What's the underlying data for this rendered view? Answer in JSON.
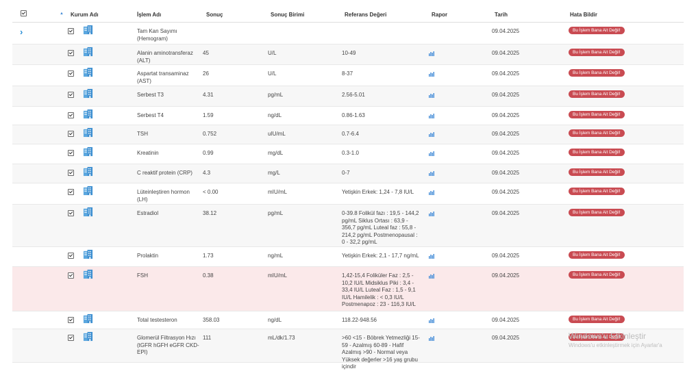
{
  "header": {
    "kurum_adi": "Kurum Adı",
    "islem_adi": "İşlem Adı",
    "sonuc": "Sonuç",
    "sonuc_birimi": "Sonuç Birimi",
    "referans": "Referans Değeri",
    "rapor": "Rapor",
    "tarih": "Tarih",
    "hata": "Hata Bildir"
  },
  "button_label": "Bu İşlem Bana Ait Değil!",
  "rows": [
    {
      "name": "Tam Kan Sayımı (Hemogram)",
      "result": "",
      "unit": "",
      "ref": "",
      "date": "09.04.2025",
      "report": false
    },
    {
      "name": "Alanin aminotransferaz (ALT)",
      "result": "45",
      "unit": "U/L",
      "ref": "10-49",
      "date": "09.04.2025",
      "report": true
    },
    {
      "name": "Aspartat transaminaz (AST)",
      "result": "26",
      "unit": "U/L",
      "ref": "8-37",
      "date": "09.04.2025",
      "report": true
    },
    {
      "name": "Serbest T3",
      "result": "4.31",
      "unit": "pg/mL",
      "ref": "2.56-5.01",
      "date": "09.04.2025",
      "report": true
    },
    {
      "name": "Serbest T4",
      "result": "1.59",
      "unit": "ng/dL",
      "ref": "0.86-1.63",
      "date": "09.04.2025",
      "report": true
    },
    {
      "name": "TSH",
      "result": "0.752",
      "unit": "uIU/mL",
      "ref": "0.7-6.4",
      "date": "09.04.2025",
      "report": true
    },
    {
      "name": "Kreatinin",
      "result": "0.99",
      "unit": "mg/dL",
      "ref": "0.3-1.0",
      "date": "09.04.2025",
      "report": true
    },
    {
      "name": "C reaktif protein (CRP)",
      "result": "4.3",
      "unit": "mg/L",
      "ref": "0-7",
      "date": "09.04.2025",
      "report": true
    },
    {
      "name": "Lüteinleştiren hormon (LH)",
      "result": "< 0.00",
      "unit": "mIU/mL",
      "ref": "Yetişkin Erkek: 1,24 - 7,8 IU/L",
      "date": "09.04.2025",
      "report": true
    },
    {
      "name": "Estradiol",
      "result": "38.12",
      "unit": "pg/mL",
      "ref": "0-39.8 Folikül fazı : 19,5 - 144,2 pg/mL Siklus Ortası : 63,9 - 356,7 pg/mL Luteal faz : 55,8 - 214,2 pg/mL Postmenopausal : 0 - 32,2 pg/mL",
      "date": "09.04.2025",
      "report": true
    },
    {
      "name": "Prolaktin",
      "result": "1.73",
      "unit": "ng/mL",
      "ref": "Yetişkin Erkek: 2,1 - 17,7 ng/mL",
      "date": "09.04.2025",
      "report": true
    },
    {
      "name": "FSH",
      "result": "0.38",
      "unit": "mIU/mL",
      "ref": "1,42-15,4 Foliküler Faz : 2,5 - 10,2 IU/L Midsiklus Piki : 3,4 - 33,4 IU/L Luteal Faz : 1,5 - 9,1 IU/L Hamilelik : < 0,3 IU/L Postmenapoz : 23 - 116,3 IU/L",
      "date": "09.04.2025",
      "report": true
    },
    {
      "name": "Total testesteron",
      "result": "358.03",
      "unit": "ng/dL",
      "ref": "118.22-948.56",
      "date": "09.04.2025",
      "report": true
    },
    {
      "name": "Glomerül Filtrasyon Hızı (tGFR hGFH eGFR CKD-EPI)",
      "result": "111",
      "unit": "mL/dk/1.73",
      "ref": ">60 <15 - Böbrek Yetmezliği 15-59 - Azalmış 60-89 - Hafif Azalmış >90 - Normal veya Yüksek değerler >16 yaş grubu içindir",
      "date": "09.04.2025",
      "report": true
    }
  ],
  "watermark": {
    "line1": "Windows'u Etkinleştir",
    "line2": "Windows'u etkinleştirmek için Ayarlar'a"
  }
}
